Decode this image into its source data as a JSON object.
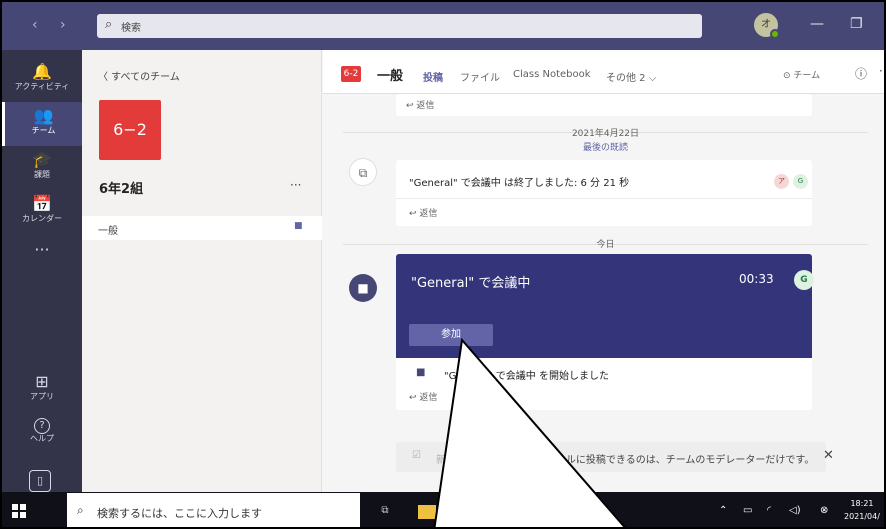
{
  "titlebar": {
    "back_glyph": "‹",
    "forward_glyph": "›",
    "search_placeholder": "検索",
    "user_initial": "オ",
    "minimize": "—",
    "maximize": "❐"
  },
  "rail": {
    "items": [
      {
        "label": "アクティビティ",
        "icon": "bell-icon",
        "glyph": "🔔"
      },
      {
        "label": "チーム",
        "icon": "teams-icon",
        "glyph": "👥"
      },
      {
        "label": "課題",
        "icon": "assignments-icon",
        "glyph": "🎓"
      },
      {
        "label": "カレンダー",
        "icon": "calendar-icon",
        "glyph": "📅"
      },
      {
        "label": "",
        "icon": "more-icon",
        "glyph": "···"
      },
      {
        "label": "アプリ",
        "icon": "apps-icon",
        "glyph": "⊞"
      },
      {
        "label": "ヘルプ",
        "icon": "help-icon",
        "glyph": "?"
      }
    ],
    "device_glyph": "▯"
  },
  "team_panel": {
    "back_label": "〈  すべてのチーム",
    "tile_text": "6−2",
    "team_name": "6年2組",
    "more": "···",
    "channel_name": "一般"
  },
  "channel_header": {
    "badge": "6-2",
    "title": "一般",
    "tabs": [
      "投稿",
      "ファイル",
      "Class Notebook",
      "その他 2 ⌵"
    ],
    "team_button": "⊙ チーム",
    "info_glyph": "ⓘ",
    "more_glyph": "···"
  },
  "messages": {
    "top_reply": "返信",
    "date_1": "2021年4月22日",
    "last_read": "最後の既読",
    "meeting_ended_text": "\"General\" で会議中 は終了しました: 6 分 21 秒",
    "ended_avatars": [
      "ア",
      "G"
    ],
    "ended_reply": "返信",
    "date_today": "今日",
    "meeting_title": "\"General\" で会議中",
    "meeting_time": "00:33",
    "meeting_avatar": "G",
    "join_label": "参加",
    "started_text": "\"General\" で会議中 を開始しました",
    "started_reply": "返信",
    "compose_icon": "☑",
    "compose_new": "新",
    "compose_restriction": "このチャネルに投稿できるのは、チームのモデレーターだけです。",
    "compose_close": "✕"
  },
  "taskbar": {
    "search_placeholder": "検索するには、ここに入力します",
    "time": "18:21",
    "date": "2021/04/"
  },
  "colors": {
    "titlebar": "#464775",
    "rail": "#33344a",
    "meeting_card": "#33347a",
    "accent": "#6264a7",
    "team_tile": "#e33a3a"
  }
}
